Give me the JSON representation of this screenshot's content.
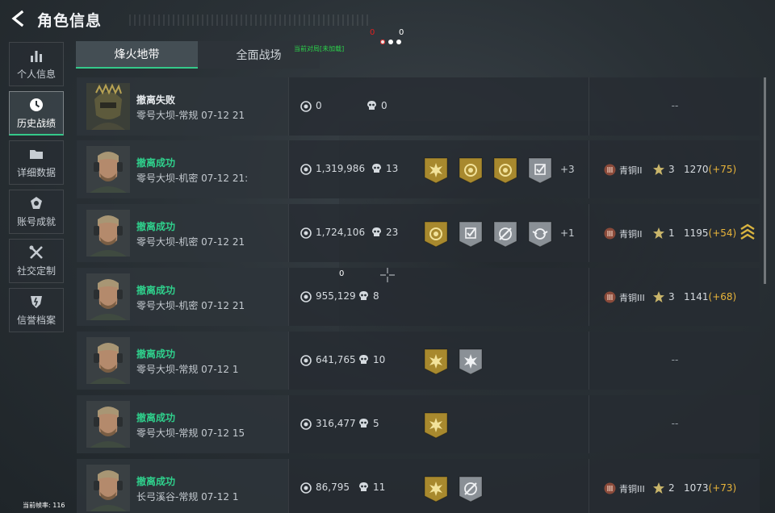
{
  "header": {
    "title": "角色信息"
  },
  "sidebar": {
    "items": [
      {
        "label": "个人信息",
        "icon": "bar-chart-icon"
      },
      {
        "label": "历史战绩",
        "icon": "clock-icon",
        "active": true
      },
      {
        "label": "详细数据",
        "icon": "folder-icon"
      },
      {
        "label": "账号成就",
        "icon": "badge-icon"
      },
      {
        "label": "社交定制",
        "icon": "tools-icon"
      },
      {
        "label": "信誉档案",
        "icon": "shield-icon"
      }
    ]
  },
  "tabs": [
    {
      "label": "烽火地带",
      "active": true
    },
    {
      "label": "全面战场",
      "active": false
    }
  ],
  "overlay": {
    "green_text": "当前对局[未加载]",
    "red_num": "0",
    "white_num": "0",
    "center_num": "0",
    "fps_text": "当前帧率: 116"
  },
  "colors": {
    "success": "#2fd08c",
    "accent": "#34c98a",
    "delta": "#e8b43a",
    "medal_gold": "#a8892e",
    "medal_gray": "#8a9096"
  },
  "records": [
    {
      "status": "撤离失败",
      "result": "fail",
      "map": "零号大坝-常规 07-12 21",
      "value": "0",
      "kills": "0",
      "medals": [],
      "extra": "",
      "rank": null
    },
    {
      "status": "撤离成功",
      "result": "ok",
      "map": "零号大坝-机密 07-12 21:",
      "value": "1,319,986",
      "kills": "13",
      "medals": [
        "gold-burst",
        "gold-circle",
        "gold-circle",
        "gray-check"
      ],
      "extra": "+3",
      "rank": {
        "name": "青铜II",
        "stars": "3",
        "score": "1270",
        "delta": "(+75)"
      }
    },
    {
      "status": "撤离成功",
      "result": "ok",
      "map": "零号大坝-机密 07-12 21",
      "value": "1,724,106",
      "kills": "23",
      "medals": [
        "gold-circle",
        "gray-check",
        "gray-target",
        "gray-wings"
      ],
      "extra": "+1",
      "rank": {
        "name": "青铜II",
        "stars": "1",
        "score": "1195",
        "delta": "(+54)"
      },
      "promo": true
    },
    {
      "status": "撤离成功",
      "result": "ok",
      "map": "零号大坝-机密 07-12 21",
      "value": "955,129",
      "kills": "8",
      "medals": [],
      "extra": "",
      "rank": {
        "name": "青铜III",
        "stars": "3",
        "score": "1141",
        "delta": "(+68)"
      }
    },
    {
      "status": "撤离成功",
      "result": "ok",
      "map": "零号大坝-常规 07-12 1",
      "value": "641,765",
      "kills": "10",
      "medals": [
        "gold-burst",
        "gray-burst"
      ],
      "extra": "",
      "rank": null
    },
    {
      "status": "撤离成功",
      "result": "ok",
      "map": "零号大坝-常规 07-12 15",
      "value": "316,477",
      "kills": "5",
      "medals": [
        "gold-burst"
      ],
      "extra": "",
      "rank": null
    },
    {
      "status": "撤离成功",
      "result": "ok",
      "map": "长弓溪谷-常规 07-12 1",
      "value": "86,795",
      "kills": "11",
      "medals": [
        "gold-burst",
        "gray-target"
      ],
      "extra": "",
      "rank": {
        "name": "青铜III",
        "stars": "2",
        "score": "1073",
        "delta": "(+73)"
      }
    }
  ],
  "empty_rank": "--"
}
